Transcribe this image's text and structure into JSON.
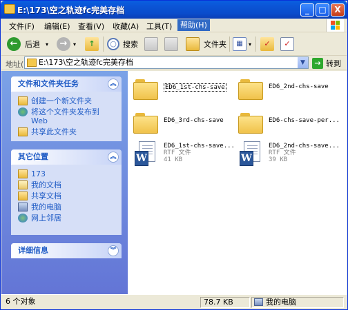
{
  "window": {
    "title": "E:\\173\\空之轨迹fc完美存档",
    "minimize_label": "_",
    "maximize_label": "□",
    "close_label": "X"
  },
  "menu": {
    "items": [
      "文件(F)",
      "编辑(E)",
      "查看(V)",
      "收藏(A)",
      "工具(T)",
      "帮助(H)"
    ],
    "active_index": 5
  },
  "toolbar": {
    "back_label": "后退",
    "search_label": "搜索",
    "folders_label": "文件夹"
  },
  "address": {
    "label": "地址(D)",
    "value": "E:\\173\\空之轨迹fc完美存档",
    "go_label": "转到"
  },
  "tasks_panel": {
    "title": "文件和文件夹任务",
    "items": [
      "创建一个新文件夹",
      "将这个文件夹发布到 Web",
      "共享此文件夹"
    ]
  },
  "places_panel": {
    "title": "其它位置",
    "items": [
      "173",
      "我的文档",
      "共享文档",
      "我的电脑",
      "网上邻居"
    ]
  },
  "details_panel": {
    "title": "详细信息"
  },
  "files": [
    {
      "name": "ED6_1st-chs-save",
      "kind": "folder",
      "selected": true
    },
    {
      "name": "ED6_2nd-chs-save",
      "kind": "folder"
    },
    {
      "name": "ED6_3rd-chs-save",
      "kind": "folder"
    },
    {
      "name": "ED6-chs-save-per...",
      "kind": "folder"
    },
    {
      "name": "ED6_1st-chs-save...",
      "kind": "rtf",
      "type": "RTF 文件",
      "size": "41 KB"
    },
    {
      "name": "ED6_2nd-chs-save...",
      "kind": "rtf",
      "type": "RTF 文件",
      "size": "39 KB"
    }
  ],
  "status": {
    "count": "6 个对象",
    "size": "78.7 KB",
    "location": "我的电脑"
  },
  "colors": {
    "titlebar": "#0a4ccc",
    "panel_title": "#215dc6",
    "menu_active": "#316ac5"
  }
}
